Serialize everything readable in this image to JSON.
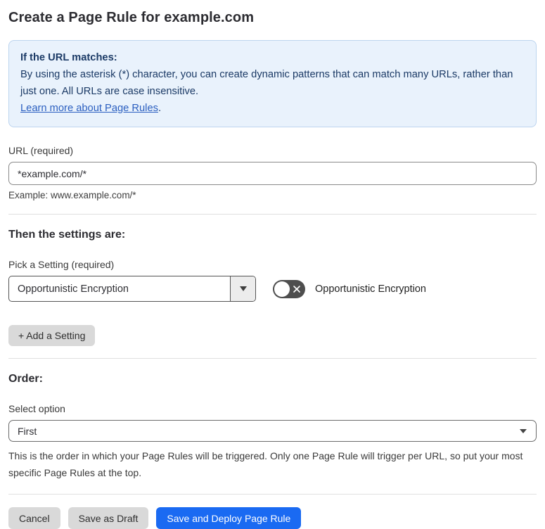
{
  "page": {
    "title": "Create a Page Rule for example.com"
  },
  "info_box": {
    "heading": "If the URL matches:",
    "body": "By using the asterisk (*) character, you can create dynamic patterns that can match many URLs, rather than just one. All URLs are case insensitive.",
    "link_label": "Learn more about Page Rules",
    "link_suffix": "."
  },
  "url_field": {
    "label": "URL (required)",
    "value": "*example.com/*",
    "helper": "Example: www.example.com/*"
  },
  "settings_section": {
    "heading": "Then the settings are:",
    "picker_label": "Pick a Setting (required)",
    "picker_value": "Opportunistic Encryption",
    "toggle_label": "Opportunistic Encryption",
    "toggle_state": "off",
    "add_setting_label": "+ Add a Setting"
  },
  "order_section": {
    "heading": "Order:",
    "select_label": "Select option",
    "select_value": "First",
    "helper": "This is the order in which your Page Rules will be triggered. Only one Page Rule will trigger per URL, so put your most specific Page Rules at the top."
  },
  "footer": {
    "cancel_label": "Cancel",
    "save_draft_label": "Save as Draft",
    "save_deploy_label": "Save and Deploy Page Rule"
  },
  "icons": {
    "dropdown_caret": "caret-down-icon",
    "toggle_off": "x-icon"
  },
  "colors": {
    "info_bg": "#e9f2fc",
    "info_border": "#bcd4ef",
    "info_text": "#1b3a66",
    "link": "#2b5fc0",
    "primary_button": "#1a6af2",
    "gray_button": "#d9d9d9",
    "toggle_bg": "#4e4e4e"
  }
}
